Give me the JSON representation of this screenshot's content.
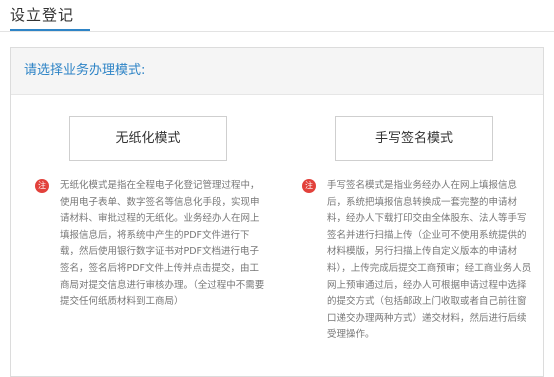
{
  "page": {
    "title": "设立登记"
  },
  "panel": {
    "header": "请选择业务办理模式:"
  },
  "modes": [
    {
      "label": "无纸化模式",
      "note_icon": "注",
      "note": "无纸化模式是指在全程电子化登记管理过程中，使用电子表单、数字签名等信息化手段，实现申请材料、审批过程的无纸化。业务经办人在网上填报信息后，将系统中产生的PDF文件进行下载，然后使用银行数字证书对PDF文档进行电子签名，签名后将PDF文件上传并点击提交，由工商局对提交信息进行审核办理。（全过程中不需要提交任何纸质材料到工商局）"
    },
    {
      "label": "手写签名模式",
      "note_icon": "注",
      "note": "手写签名模式是指业务经办人在网上填报信息后，系统把填报信息转换成一套完整的申请材料，经办人下载打印交由全体股东、法人等手写签名并进行扫描上传（企业可不使用系统提供的材料模版，另行扫描上传自定义版本的申请材料），上传完成后提交工商预审；经工商业务人员网上预审通过后，经办人可根据申请过程中选择的提交方式（包括邮政上门收取或者自己前往窗口递交办理两种方式）递交材料，然后进行后续受理操作。"
    }
  ],
  "colors": {
    "accent": "#2e84c6",
    "note_icon": "#e2413b"
  }
}
